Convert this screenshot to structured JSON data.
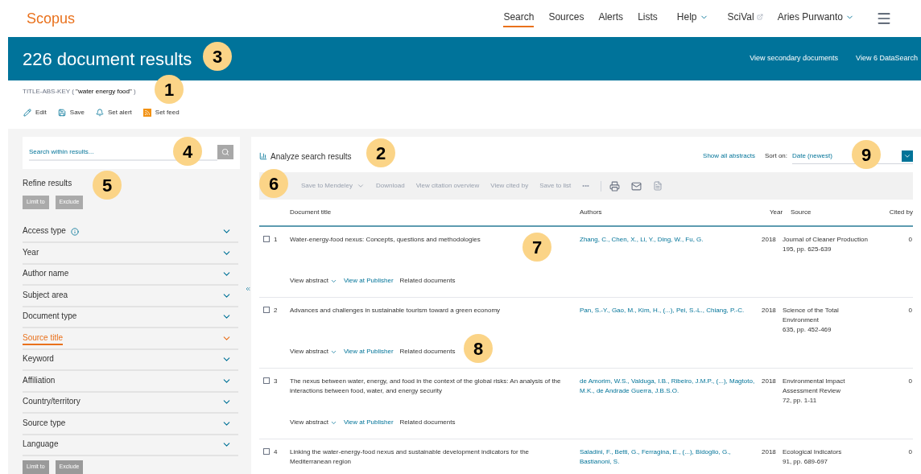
{
  "brand": "Scopus",
  "nav": [
    {
      "label": "Search",
      "selected": true,
      "kind": "link"
    },
    {
      "label": "Sources",
      "selected": false,
      "kind": "link"
    },
    {
      "label": "Alerts",
      "selected": false,
      "kind": "link"
    },
    {
      "label": "Lists",
      "selected": false,
      "kind": "link"
    },
    {
      "label": "Help",
      "selected": false,
      "kind": "dropdown"
    },
    {
      "label": "SciVal",
      "selected": false,
      "kind": "external"
    },
    {
      "label": "Aries Purwanto",
      "selected": false,
      "kind": "dropdown"
    }
  ],
  "banner": {
    "title": "226 document results",
    "links": [
      "View secondary documents",
      "View 6 DataSearch"
    ]
  },
  "query": {
    "field": "TITLE-ABS-KEY (",
    "term": "\"water energy food\"",
    "close": ")"
  },
  "query_actions": [
    {
      "label": "Edit",
      "kind": "edit"
    },
    {
      "label": "Save",
      "kind": "save"
    },
    {
      "label": "Set alert",
      "kind": "alert"
    },
    {
      "label": "Set feed",
      "kind": "feed"
    }
  ],
  "sidebar": {
    "search": {
      "placeholder": "Search within results..."
    },
    "title": "Refine results",
    "buttons": [
      "Limit to",
      "Exclude"
    ],
    "facets": [
      {
        "label": "Access type",
        "info": true,
        "selected": false
      },
      {
        "label": "Year",
        "info": false,
        "selected": false
      },
      {
        "label": "Author name",
        "info": false,
        "selected": false
      },
      {
        "label": "Subject area",
        "info": false,
        "selected": false
      },
      {
        "label": "Document type",
        "info": false,
        "selected": false
      },
      {
        "label": "Source title",
        "info": false,
        "selected": true
      },
      {
        "label": "Keyword",
        "info": false,
        "selected": false
      },
      {
        "label": "Affiliation",
        "info": false,
        "selected": false
      },
      {
        "label": "Country/territory",
        "info": false,
        "selected": false
      },
      {
        "label": "Source type",
        "info": false,
        "selected": false
      },
      {
        "label": "Language",
        "info": false,
        "selected": false
      }
    ],
    "bottom_buttons": [
      "Limit to",
      "Exclude"
    ]
  },
  "results": {
    "analyze": "Analyze search results",
    "show_abstracts": "Show all abstracts",
    "sort_label": "Sort on:",
    "sort_value": "Date (newest)",
    "toolbar": [
      {
        "label": "Save to Mendeley",
        "kind": "dropdown"
      },
      {
        "label": "Download",
        "kind": "text"
      },
      {
        "label": "View citation overview",
        "kind": "text"
      },
      {
        "label": "View cited by",
        "kind": "text"
      },
      {
        "label": "Save to list",
        "kind": "text"
      },
      {
        "label": "•••",
        "kind": "text"
      },
      {
        "kind": "print"
      },
      {
        "kind": "email"
      },
      {
        "kind": "bibliography"
      }
    ],
    "columns": [
      "Document title",
      "Authors",
      "Year",
      "Source",
      "Cited by"
    ],
    "rows": [
      {
        "number": "1",
        "checked": false,
        "title": "Water-energy-food nexus: Concepts, questions and methodologies",
        "authors": "Zhang, C., Chen, X., Li, Y., Ding, W., Fu, G.",
        "year": "2018",
        "source": [
          "Journal of Cleaner Production",
          "195, pp. 625-639"
        ],
        "cited_by": "0",
        "links": [
          "View abstract",
          "View at Publisher",
          "Related documents"
        ]
      },
      {
        "number": "2",
        "checked": false,
        "title": "Advances and challenges in sustainable tourism toward a green economy",
        "authors": "Pan, S.-Y., Gao, M., Kim, H., (...), Pei, S.-L., Chiang, P.-C.",
        "year": "2018",
        "source": [
          "Science of the Total Environment",
          "635, pp. 452-469"
        ],
        "cited_by": "0",
        "links": [
          "View abstract",
          "View at Publisher",
          "Related documents"
        ]
      },
      {
        "number": "3",
        "checked": false,
        "title": "The nexus between water, energy, and food in the context of the global risks: An analysis of the interactions between food, water, and energy security",
        "authors": "de Amorim, W.S., Valduga, I.B., Ribeiro, J.M.P., (...), Magtoto, M.K., de Andrade Guerra, J.B.S.O.",
        "year": "2018",
        "source": [
          "Environmental Impact Assessment Review",
          "72, pp. 1-11"
        ],
        "cited_by": "0",
        "links": [
          "View abstract",
          "View at Publisher",
          "Related documents"
        ]
      },
      {
        "number": "4",
        "checked": false,
        "title": "Linking the water-energy-food nexus and sustainable development indicators for the Mediterranean region",
        "authors": "Saladini, F., Betti, G., Ferragina, E., (...), Bidoglio, G., Bastianoni, S.",
        "year": "2018",
        "source": [
          "Ecological Indicators",
          "91, pp. 689-697"
        ],
        "cited_by": "0"
      }
    ]
  },
  "callouts": [
    "1",
    "2",
    "3",
    "4",
    "5",
    "6",
    "7",
    "8",
    "9"
  ]
}
